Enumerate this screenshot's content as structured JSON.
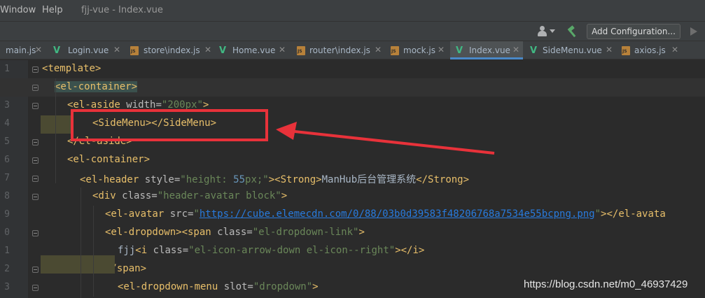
{
  "menubar": {
    "items": [
      "Window",
      "Help"
    ],
    "project_title": "fjj-vue - Index.vue"
  },
  "toolbar": {
    "user_icon": "user-icon",
    "hammer_icon": "hammer-icon",
    "add_configuration": "Add Configuration...",
    "run_icon": "play-icon"
  },
  "tabs": [
    {
      "label": "main.js",
      "icon": "js-file-icon",
      "active": false
    },
    {
      "label": "Login.vue",
      "icon": "vue-file-icon",
      "active": false
    },
    {
      "label": "store\\index.js",
      "icon": "js-file-icon",
      "active": false
    },
    {
      "label": "Home.vue",
      "icon": "vue-file-icon",
      "active": false
    },
    {
      "label": "router\\index.js",
      "icon": "js-file-icon",
      "active": false
    },
    {
      "label": "mock.js",
      "icon": "js-file-icon",
      "active": false
    },
    {
      "label": "Index.vue",
      "icon": "vue-file-icon",
      "active": true
    },
    {
      "label": "SideMenu.vue",
      "icon": "vue-file-icon",
      "active": false
    },
    {
      "label": "axios.js",
      "icon": "js-file-icon",
      "active": false
    }
  ],
  "gutter": {
    "line_numbers": [
      "1",
      "2",
      "3",
      "4",
      "5",
      "6",
      "7",
      "8",
      "9",
      "0",
      "1",
      "2",
      "3"
    ]
  },
  "code_lines": [
    {
      "tokens": [
        [
          "tg",
          "<"
        ],
        [
          "tg",
          "template"
        ],
        [
          "tg",
          ">"
        ]
      ]
    },
    {
      "tokens": [
        [
          "tg",
          "<el-container>"
        ]
      ]
    },
    {
      "tokens": [
        [
          "tg",
          "<el-aside "
        ],
        [
          "at",
          "width="
        ],
        [
          "av",
          "\"200px\""
        ],
        [
          "tg",
          ">"
        ]
      ]
    },
    {
      "tokens": [
        [
          "tg",
          "<SideMenu></SideMenu>"
        ]
      ]
    },
    {
      "tokens": [
        [
          "tg",
          "</el-aside>"
        ]
      ]
    },
    {
      "tokens": [
        [
          "tg",
          "<el-container>"
        ]
      ]
    },
    {
      "tokens": [
        [
          "tg",
          "<el-header "
        ],
        [
          "at",
          "style="
        ],
        [
          "av",
          "\"height: "
        ],
        [
          "num",
          "55"
        ],
        [
          "av",
          "px;\""
        ],
        [
          "tg",
          "><Strong>"
        ],
        [
          "tx",
          "ManHub后台管理系统"
        ],
        [
          "tg",
          "</Strong>"
        ]
      ]
    },
    {
      "tokens": [
        [
          "tg",
          "<div "
        ],
        [
          "at",
          "class="
        ],
        [
          "av",
          "\"header-avatar block\""
        ],
        [
          "tg",
          ">"
        ]
      ]
    },
    {
      "tokens": [
        [
          "tg",
          "<el-avatar "
        ],
        [
          "at",
          "src="
        ],
        [
          "av",
          "\""
        ],
        [
          "url",
          "https://cube.elemecdn.com/0/88/03b0d39583f48206768a7534e55bcpng.png"
        ],
        [
          "av",
          "\""
        ],
        [
          "tg",
          "></el-avata"
        ]
      ]
    },
    {
      "tokens": [
        [
          "tg",
          "<el-dropdown><span "
        ],
        [
          "at",
          "class="
        ],
        [
          "av",
          "\"el-dropdown-link\""
        ],
        [
          "tg",
          ">"
        ]
      ]
    },
    {
      "tokens": [
        [
          "tx",
          "fjj"
        ],
        [
          "tg",
          "<i "
        ],
        [
          "at",
          "class="
        ],
        [
          "av",
          "\"el-icon-arrow-down el-icon--right\""
        ],
        [
          "tg",
          "></i>"
        ]
      ]
    },
    {
      "tokens": [
        [
          "tg",
          "</span>"
        ]
      ]
    },
    {
      "tokens": [
        [
          "tg",
          "<el-dropdown-menu "
        ],
        [
          "at",
          "slot="
        ],
        [
          "av",
          "\"dropdown\""
        ],
        [
          "tg",
          ">"
        ]
      ]
    }
  ],
  "annotation": {
    "box_color": "#e8323a",
    "arrow_color": "#e8323a"
  },
  "watermark": "https://blog.csdn.net/m0_46937429"
}
